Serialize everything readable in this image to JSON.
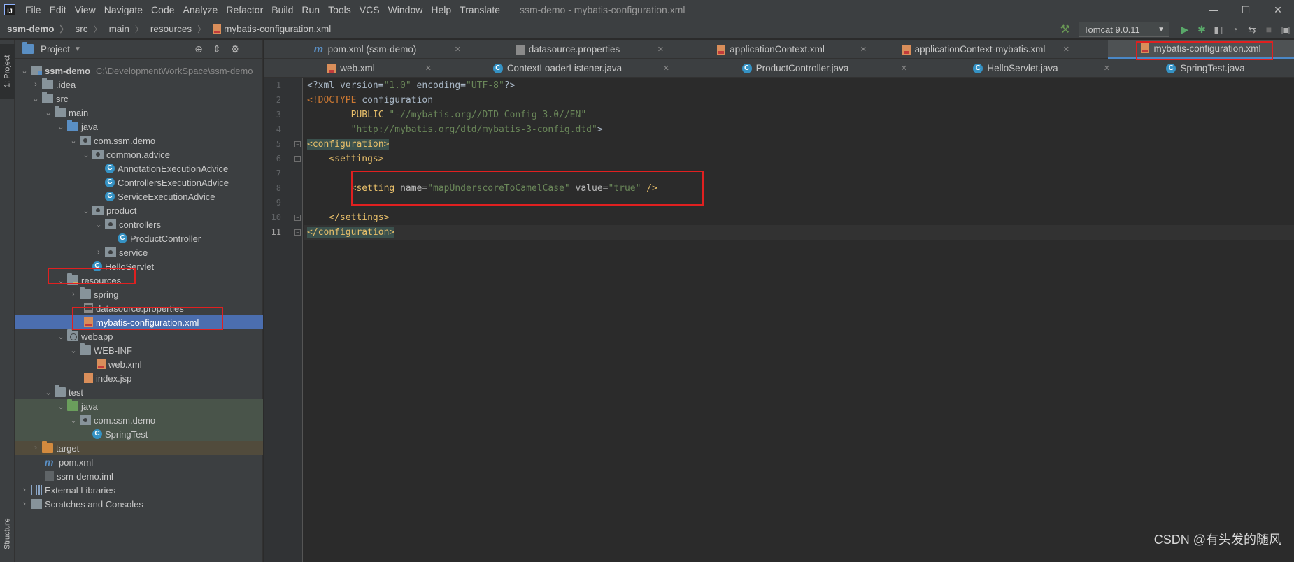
{
  "menubar": {
    "app_logo": "IJ",
    "items": [
      "File",
      "Edit",
      "View",
      "Navigate",
      "Code",
      "Analyze",
      "Refactor",
      "Build",
      "Run",
      "Tools",
      "VCS",
      "Window",
      "Help",
      "Translate"
    ],
    "window_title": "ssm-demo - mybatis-configuration.xml",
    "controls": [
      "—",
      "☐",
      "✕"
    ]
  },
  "navbar": {
    "breadcrumbs": [
      "ssm-demo",
      "src",
      "main",
      "resources",
      "mybatis-configuration.xml"
    ],
    "run_config": "Tomcat 9.0.11"
  },
  "stripe": {
    "project": "1: Project",
    "structure": "Structure"
  },
  "project_panel": {
    "title": "Project",
    "tree": {
      "root": "ssm-demo",
      "root_path": "C:\\DevelopmentWorkSpace\\ssm-demo",
      "idea": ".idea",
      "src": "src",
      "main": "main",
      "java": "java",
      "pkg": "com.ssm.demo",
      "common_advice": "common.advice",
      "annotation_advice": "AnnotationExecutionAdvice",
      "controllers_advice": "ControllersExecutionAdvice",
      "service_advice": "ServiceExecutionAdvice",
      "product": "product",
      "controllers": "controllers",
      "product_controller": "ProductController",
      "service": "service",
      "hello_servlet": "HelloServlet",
      "resources": "resources",
      "spring": "spring",
      "datasource": "datasource.properties",
      "mybatis_config": "mybatis-configuration.xml",
      "webapp": "webapp",
      "web_inf": "WEB-INF",
      "web_xml": "web.xml",
      "index_jsp": "index.jsp",
      "test": "test",
      "test_java": "java",
      "test_pkg": "com.ssm.demo",
      "spring_test": "SpringTest",
      "target": "target",
      "pom": "pom.xml",
      "iml": "ssm-demo.iml",
      "external_libs": "External Libraries",
      "scratches": "Scratches and Consoles"
    }
  },
  "tabs": {
    "row1": [
      "pom.xml (ssm-demo)",
      "datasource.properties",
      "applicationContext.xml",
      "applicationContext-mybatis.xml",
      "mybatis-configuration.xml"
    ],
    "row2": [
      "web.xml",
      "ContextLoaderListener.java",
      "ProductController.java",
      "HelloServlet.java",
      "SpringTest.java"
    ]
  },
  "editor": {
    "line_numbers": [
      "1",
      "2",
      "3",
      "4",
      "5",
      "6",
      "7",
      "8",
      "9",
      "10",
      "11"
    ],
    "l1_a": "<?xml version=",
    "l1_b": "\"1.0\"",
    "l1_c": " encoding=",
    "l1_d": "\"UTF-8\"",
    "l1_e": "?>",
    "l2_a": "<!DOCTYPE ",
    "l2_b": "configuration",
    "l3_a": "        PUBLIC ",
    "l3_b": "\"-//mybatis.org//DTD Config 3.0//EN\"",
    "l4_a": "        ",
    "l4_b": "\"http://mybatis.org/dtd/mybatis-3-config.dtd\"",
    "l4_c": ">",
    "l5": "<configuration>",
    "l6": "    <settings>",
    "l8_a": "        <setting ",
    "l8_b": "name=",
    "l8_c": "\"mapUnderscoreToCamelCase\"",
    "l8_d": " value=",
    "l8_e": "\"true\"",
    "l8_f": " />",
    "l10": "    </settings>",
    "l11": "</configuration>"
  },
  "watermark": "CSDN @有头发的随风"
}
